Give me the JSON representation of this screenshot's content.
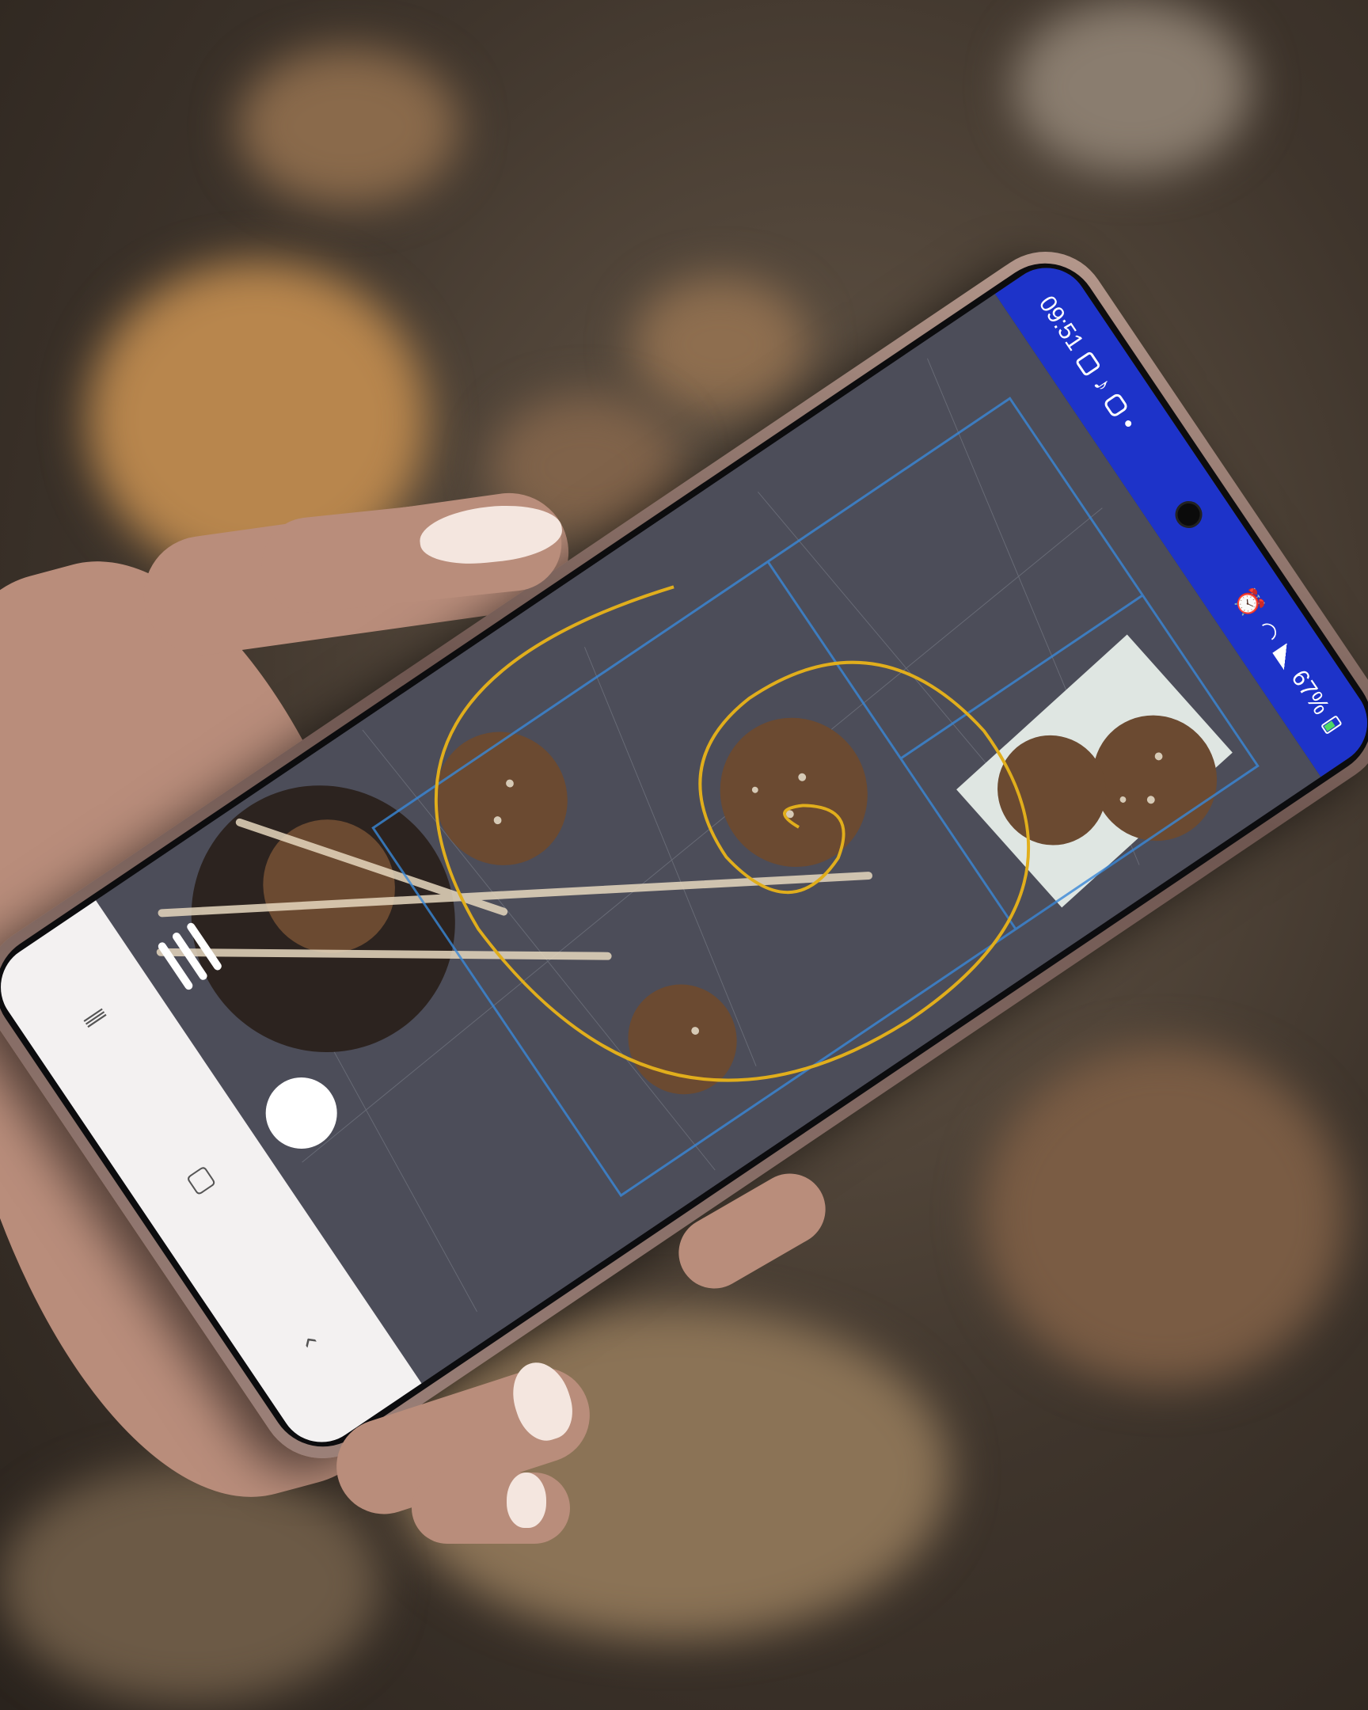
{
  "phone": {
    "status_bar": {
      "time": "09:51",
      "battery": "67%",
      "color": "#1d33c9",
      "icons": [
        "notification-square-icon",
        "tiktok-icon",
        "instagram-icon",
        "dot-icon",
        "alarm-icon",
        "wifi-icon",
        "signal-icon",
        "battery-icon"
      ]
    },
    "camera_overlay": {
      "guide": "golden-spiral-icon",
      "guide_color": "#e1ae1c",
      "grid_color": "#3a88d8"
    },
    "nav_bar": {
      "icons": [
        "recents-icon",
        "home-icon",
        "back-icon"
      ]
    },
    "shutter_icon": "shutter-button-icon",
    "menu_icon": "menu-icon"
  }
}
